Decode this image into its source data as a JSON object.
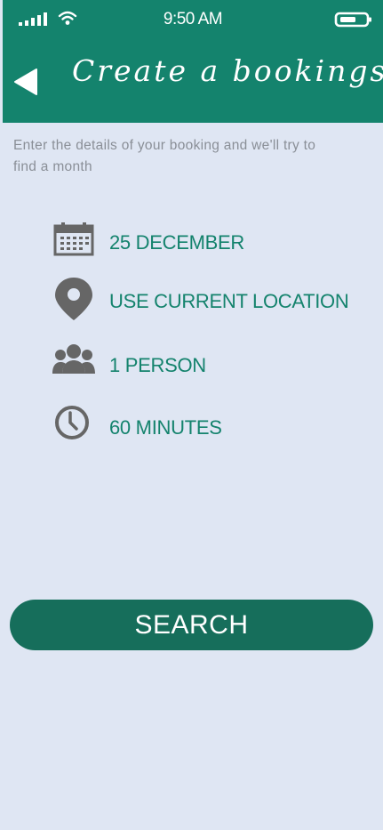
{
  "status_bar": {
    "time": "9:50 AM",
    "signal-icon": "signal-bars",
    "wifi-icon": "wifi",
    "battery-icon": "battery"
  },
  "header": {
    "title": "Create a bookings",
    "back_icon": "back-arrow-icon"
  },
  "intro": {
    "text": "Enter the details of your booking and we'll try to find a month"
  },
  "options": [
    {
      "icon": "calendar-icon",
      "label": "25 DECEMBER"
    },
    {
      "icon": "location-pin-icon",
      "label": "USE CURRENT LOCATION"
    },
    {
      "icon": "people-icon",
      "label": "1 PERSON"
    },
    {
      "icon": "clock-icon",
      "label": "60 MINUTES"
    }
  ],
  "search": {
    "label": "SEARCH"
  },
  "colors": {
    "accent": "#14836d",
    "button": "#166e5b",
    "background": "#dfe6f3",
    "icon": "#666666",
    "hint": "#8a8f97"
  }
}
